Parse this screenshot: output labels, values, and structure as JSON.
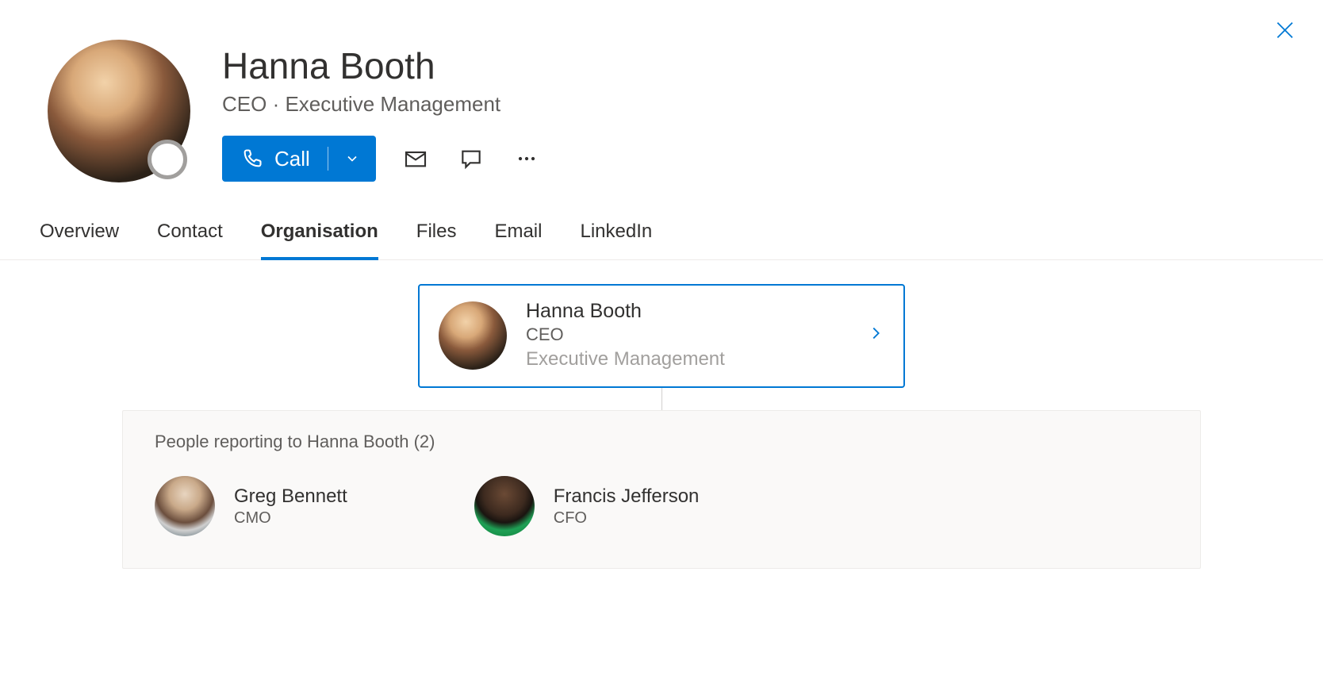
{
  "person": {
    "name": "Hanna Booth",
    "role": "CEO",
    "department": "Executive Management",
    "subtitle": "CEO  ·  Executive Management"
  },
  "actions": {
    "call_label": "Call"
  },
  "tabs": [
    {
      "label": "Overview"
    },
    {
      "label": "Contact"
    },
    {
      "label": "Organisation"
    },
    {
      "label": "Files"
    },
    {
      "label": "Email"
    },
    {
      "label": "LinkedIn"
    }
  ],
  "active_tab": "Organisation",
  "org": {
    "self": {
      "name": "Hanna Booth",
      "title": "CEO",
      "department": "Executive Management"
    },
    "reports_heading": "People reporting to Hanna Booth (2)",
    "reports": [
      {
        "name": "Greg Bennett",
        "title": "CMO"
      },
      {
        "name": "Francis Jefferson",
        "title": "CFO"
      }
    ]
  }
}
